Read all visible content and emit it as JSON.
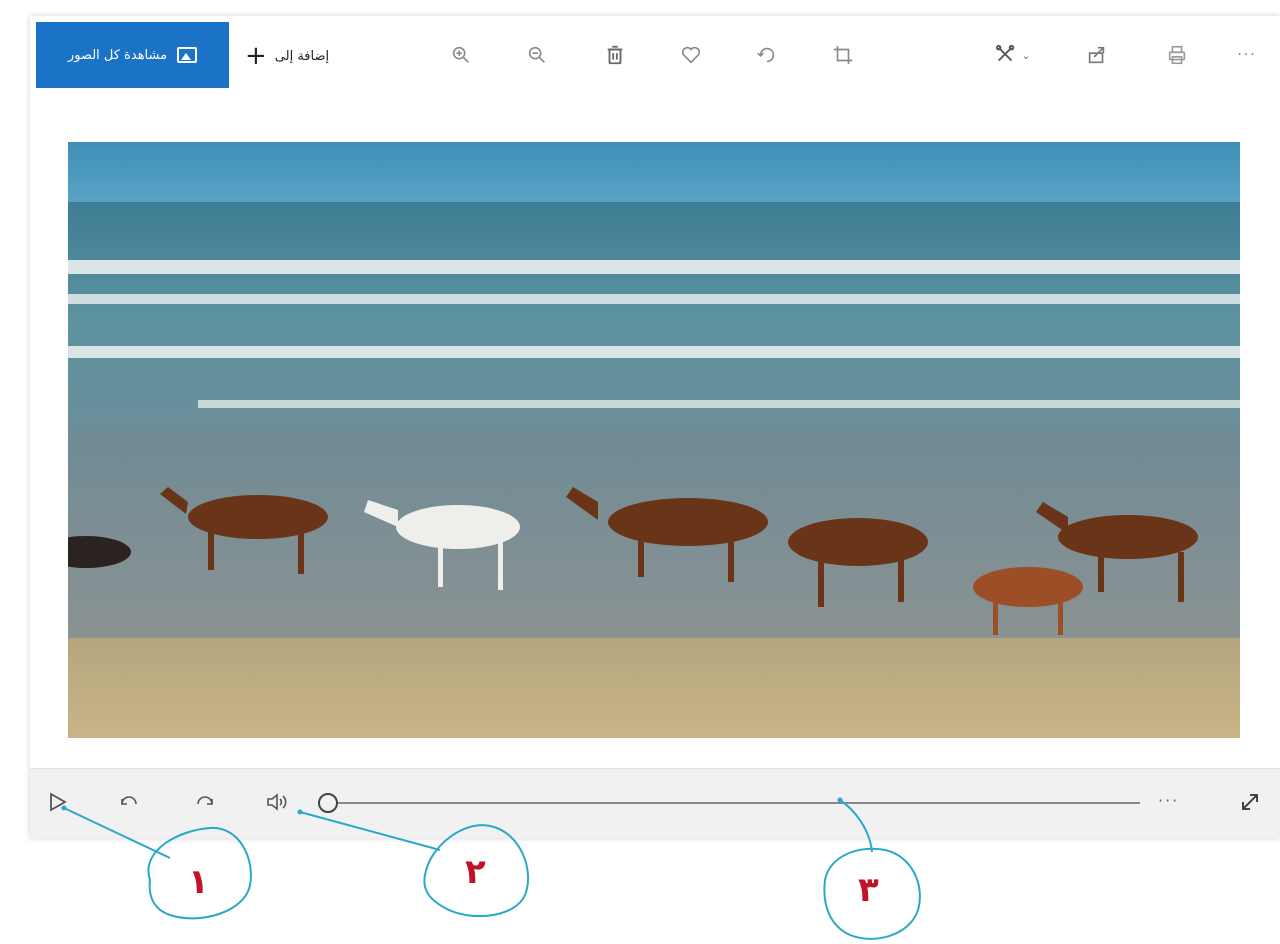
{
  "toolbar": {
    "see_all_label": "مشاهدة كل الصور",
    "add_to_label": "إضافة إلى",
    "icons": [
      "zoom-in-icon",
      "zoom-out-icon",
      "delete-icon",
      "heart-icon",
      "rotate-icon",
      "crop-icon",
      "edit-icon",
      "share-icon",
      "print-icon",
      "more-icon"
    ]
  },
  "photo": {
    "subject": "horses-running-on-beach"
  },
  "player": {
    "progress": 0,
    "more_label": "···"
  },
  "annotations": {
    "callout_1": "١",
    "callout_2": "٢",
    "callout_3": "٣",
    "color": "#c0122a",
    "line_color": "#2aa7c9"
  }
}
